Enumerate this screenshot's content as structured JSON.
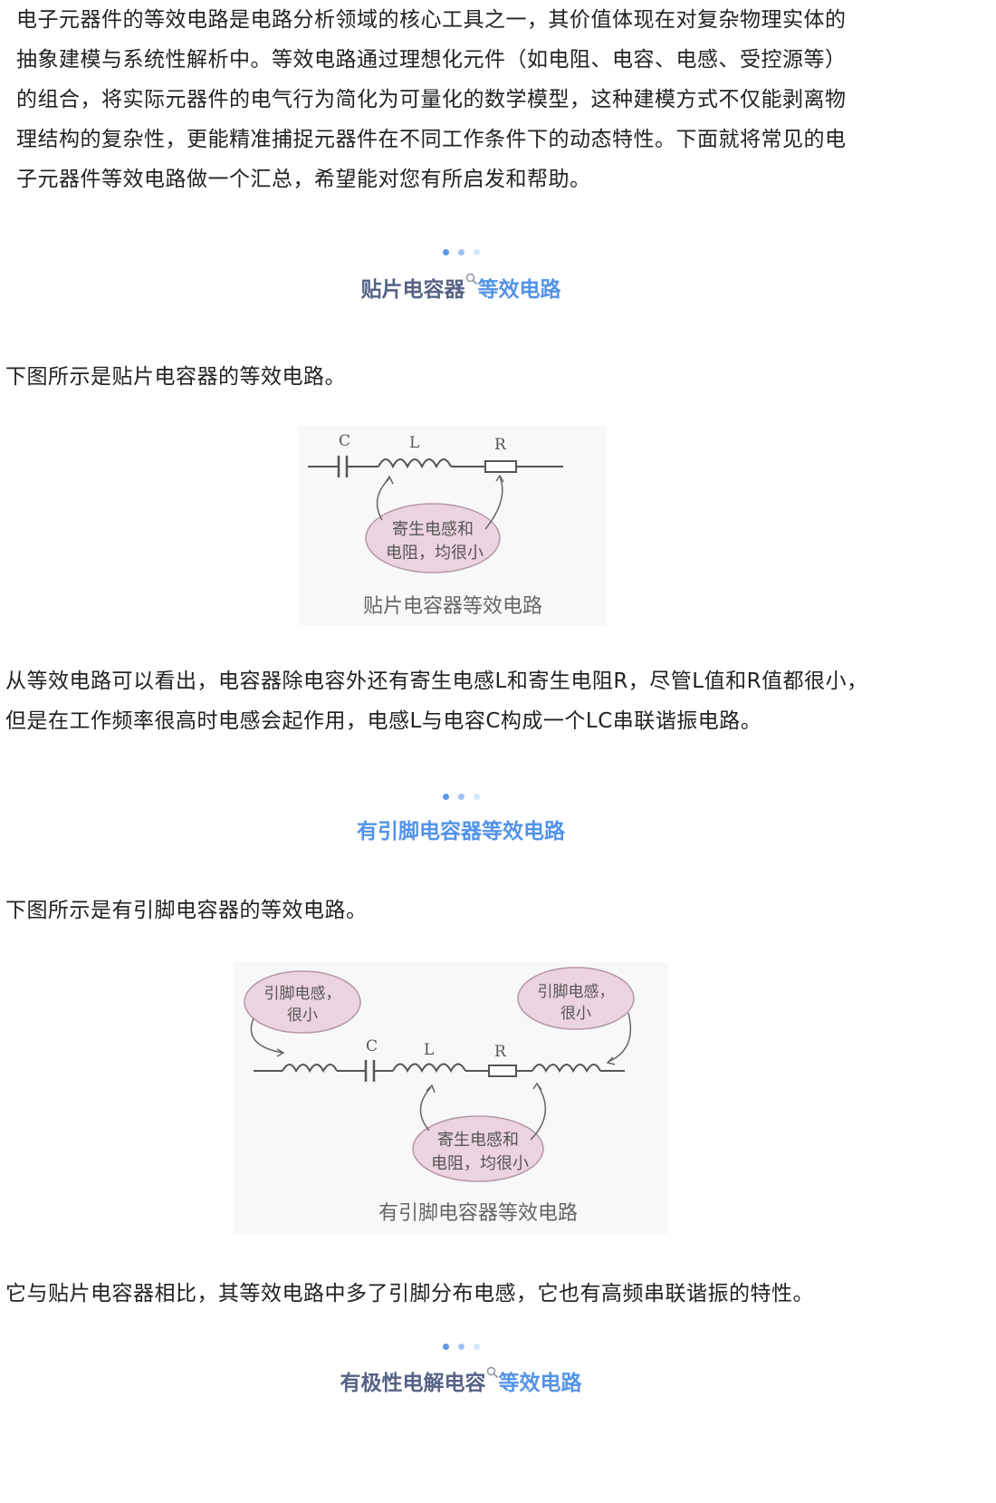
{
  "intro": {
    "lines": [
      "电子元器件的等效电路是电路分析领域的核心工具之一，其价值体现在对复杂物理实体的",
      "抽象建模与系统性解析中。等效电路通过理想化元件（如电阻、电容、电感、受控源等）",
      "的组合，将实际元器件的电气行为简化为可量化的数学模型，这种建模方式不仅能剥离物",
      "理结构的复杂性，更能精准捕捉元器件在不同工作条件下的动态特性。下面就将常见的电",
      "子元器件等效电路做一个汇总，希望能对您有所启发和帮助。"
    ]
  },
  "colors": {
    "dot1": "#5b9bea",
    "dot2": "#9ec3f3",
    "dot3": "#d6e6fb",
    "heading_dark": "#566387",
    "heading_blue": "#5393e8",
    "bubble": "#ecd3e0",
    "wire": "#555555"
  },
  "section1": {
    "heading_dark": "贴片电容器",
    "heading_blue": "等效电路",
    "intro": "下图所示是贴片电容器的等效电路。",
    "figure": {
      "label_c": "C",
      "label_l": "L",
      "label_r": "R",
      "bubble_line1": "寄生电感和",
      "bubble_line2": "电阻，均很小",
      "caption": "贴片电容器等效电路"
    },
    "text_lines": [
      "从等效电路可以看出，电容器除电容外还有寄生电感L和寄生电阻R，尽管L值和R值都很小，",
      "但是在工作频率很高时电感会起作用，电感L与电容C构成一个LC串联谐振电路。"
    ]
  },
  "section2": {
    "heading": "有引脚电容器等效电路",
    "intro": "下图所示是有引脚电容器的等效电路。",
    "figure": {
      "left_bubble_line1": "引脚电感，",
      "left_bubble_line2": "很小",
      "right_bubble_line1": "引脚电感，",
      "right_bubble_line2": "很小",
      "label_c": "C",
      "label_l": "L",
      "label_r": "R",
      "bubble_line1": "寄生电感和",
      "bubble_line2": "电阻，均很小",
      "caption": "有引脚电容器等效电路"
    },
    "text": "它与贴片电容器相比，其等效电路中多了引脚分布电感，它也有高频串联谐振的特性。"
  },
  "section3": {
    "heading_dark": "有极性电解电容",
    "heading_blue": "等效电路"
  }
}
